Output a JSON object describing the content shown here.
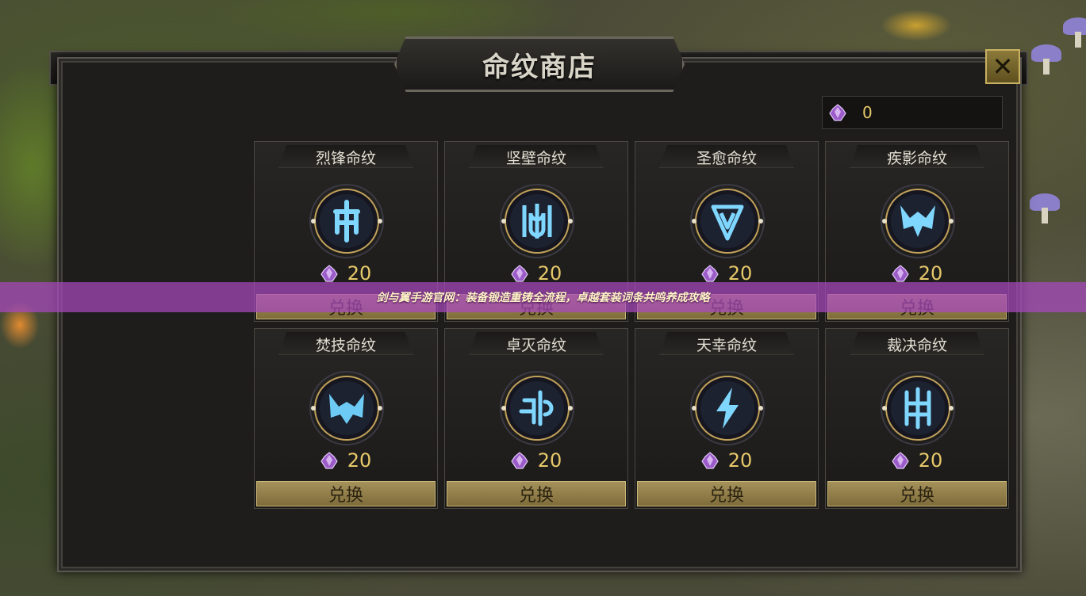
{
  "shop": {
    "title": "命纹商店",
    "close_label": "✕",
    "currency_icon": "purple-crystal-icon",
    "currency_value": "0",
    "exchange_label": "兑换",
    "accent_color": "#e7c86a"
  },
  "items": [
    {
      "name": "烈锋命纹",
      "price": "20",
      "icon": "lie-feng-rune-icon"
    },
    {
      "name": "坚壁命纹",
      "price": "20",
      "icon": "jian-bi-rune-icon"
    },
    {
      "name": "圣愈命纹",
      "price": "20",
      "icon": "sheng-yu-rune-icon"
    },
    {
      "name": "疾影命纹",
      "price": "20",
      "icon": "ji-ying-rune-icon"
    },
    {
      "name": "焚技命纹",
      "price": "20",
      "icon": "fen-ji-rune-icon"
    },
    {
      "name": "卓灭命纹",
      "price": "20",
      "icon": "zhuo-mie-rune-icon"
    },
    {
      "name": "天幸命纹",
      "price": "20",
      "icon": "tian-xing-rune-icon"
    },
    {
      "name": "裁决命纹",
      "price": "20",
      "icon": "cai-jue-rune-icon"
    }
  ],
  "banner": {
    "text": "剑与翼手游官网：装备锻造重铸全流程，卓越套装词条共鸣养成攻略"
  }
}
